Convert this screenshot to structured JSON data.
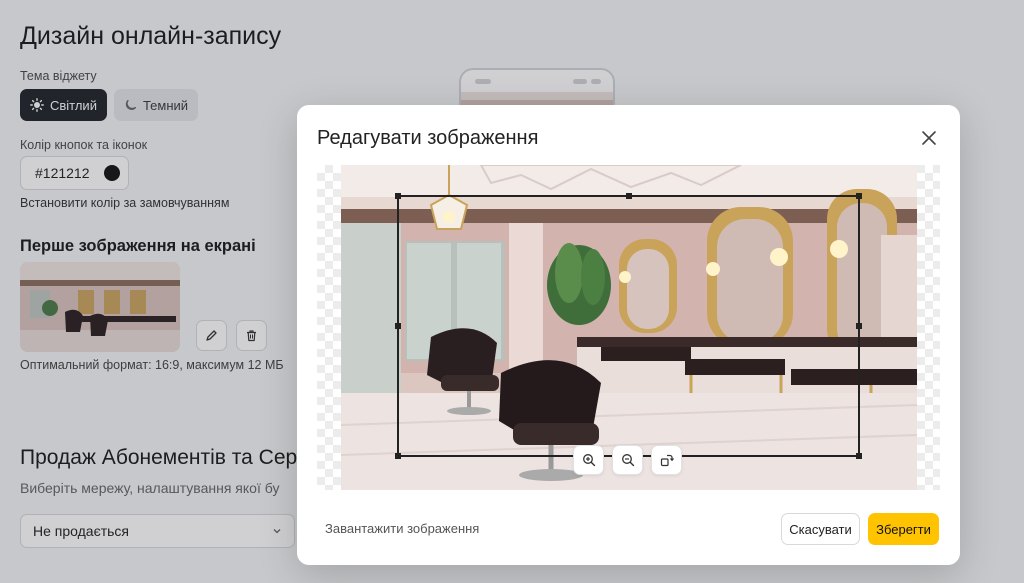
{
  "page": {
    "title": "Дизайн онлайн-запису",
    "theme_label": "Тема віджету",
    "theme_light": "Світлий",
    "theme_dark": "Темний",
    "color_label": "Колір кнопок та іконок",
    "color_value": "#121212",
    "color_reset": "Встановити колір за замовчуванням",
    "first_image_heading": "Перше зображення на екрані",
    "format_hint": "Оптимальний формат: 16:9, максимум 12 МБ",
    "sales_heading": "Продаж Абонементів та Сер",
    "sales_subtitle": "Виберіть мережу, налаштування якої бу",
    "sales_select_value": "Не продається"
  },
  "modal": {
    "title": "Редагувати зображення",
    "upload_link": "Завантажити зображення",
    "cancel_label": "Скасувати",
    "save_label": "Зберегти"
  },
  "icons": {
    "close": "close-icon",
    "zoom_in": "zoom-in-icon",
    "zoom_out": "zoom-out-icon",
    "rotate": "rotate-icon",
    "edit": "pencil-icon",
    "delete": "trash-icon",
    "sun": "sun-icon",
    "moon": "moon-icon",
    "chevron": "chevron-down-icon"
  },
  "colors": {
    "accent": "#ffc300",
    "button_color": "#121212",
    "dark_button": "#1f2329"
  }
}
